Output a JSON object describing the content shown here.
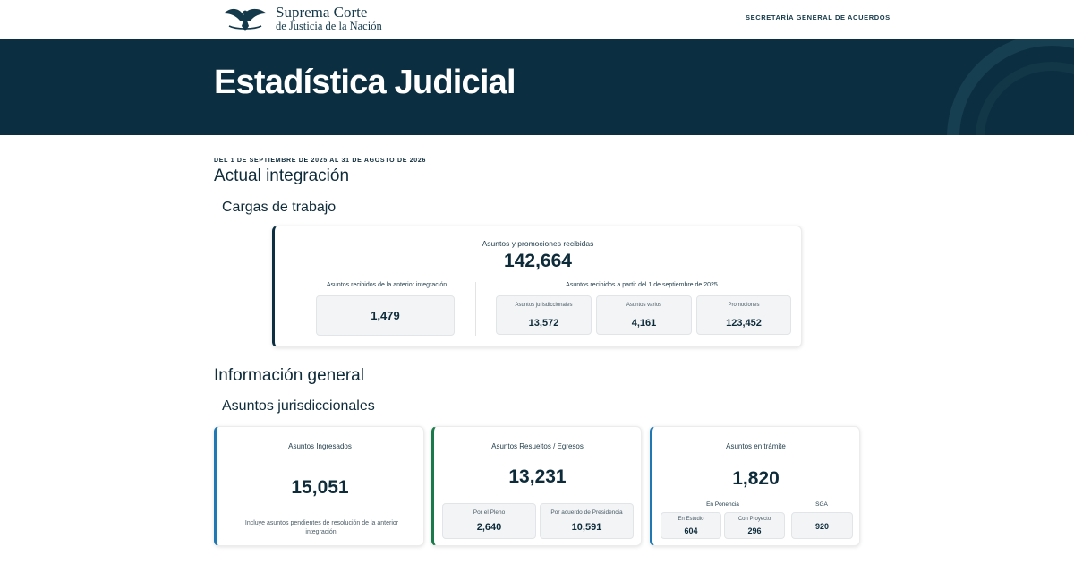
{
  "header": {
    "logo_line1": "Suprema Corte",
    "logo_line2": "de Justicia de la Nación",
    "nav_link": "SECRETARÍA GENERAL DE ACUERDOS"
  },
  "hero": {
    "title": "Estadística Judicial"
  },
  "period": "DEL 1 DE SEPTIEMBRE DE 2025 AL 31 DE AGOSTO DE 2026",
  "section1": {
    "title": "Actual integración",
    "subtitle": "Cargas de trabajo",
    "workload": {
      "title": "Asuntos y promociones recibidas",
      "total": "142,664",
      "previous": {
        "label": "Asuntos recibidos de la anterior integración",
        "value": "1,479"
      },
      "since": {
        "label": "Asuntos recibidos a partir del 1 de septiembre de 2025",
        "items": [
          {
            "label": "Asuntos jurisdiccionales",
            "value": "13,572"
          },
          {
            "label": "Asuntos varios",
            "value": "4,161"
          },
          {
            "label": "Promociones",
            "value": "123,452"
          }
        ]
      }
    }
  },
  "section2": {
    "title": "Información general",
    "subtitle": "Asuntos jurisdiccionales",
    "ingresados": {
      "title": "Asuntos Ingresados",
      "value": "15,051",
      "note": "Incluye asuntos pendientes de resolución de la anterior integración."
    },
    "resueltos": {
      "title": "Asuntos Resueltos / Egresos",
      "value": "13,231",
      "items": [
        {
          "label": "Por el Pleno",
          "value": "2,640"
        },
        {
          "label": "Por acuerdo de Presidencia",
          "value": "10,591"
        }
      ]
    },
    "tramite": {
      "title": "Asuntos en trámite",
      "value": "1,820",
      "ponencia_label": "En Ponencia",
      "ponencia_items": [
        {
          "label": "En Estudio",
          "value": "604"
        },
        {
          "label": "Con Proyecto",
          "value": "296"
        }
      ],
      "sga_label": "SGA",
      "sga_value": "920"
    }
  },
  "colors": {
    "primary": "#0b2f40",
    "accent_blue": "#1f78b4",
    "accent_green": "#1a7a4c"
  }
}
